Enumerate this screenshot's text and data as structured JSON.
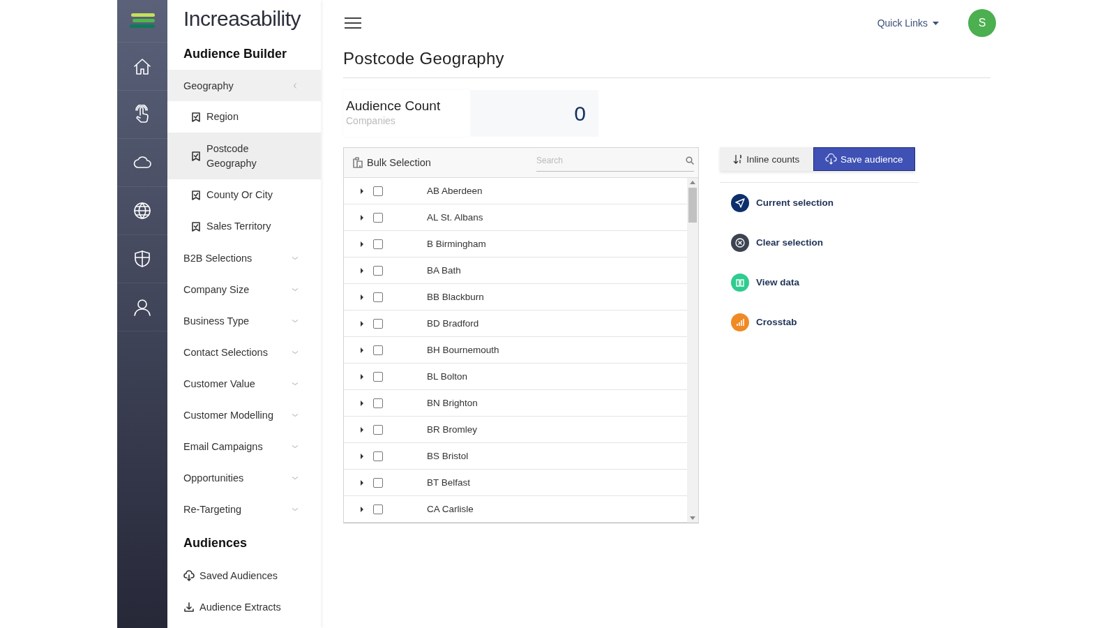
{
  "rail": {
    "items": [
      {
        "kind": "home"
      },
      {
        "kind": "touch"
      },
      {
        "kind": "cloud"
      },
      {
        "kind": "globe"
      },
      {
        "kind": "shield"
      },
      {
        "kind": "user"
      }
    ]
  },
  "sidebar": {
    "brand": "Increasability",
    "section": "Audience Builder",
    "items": [
      {
        "label": "Geography",
        "expanded": true,
        "children": [
          {
            "label": "Region",
            "selected": false
          },
          {
            "label": "Postcode Geography",
            "selected": true
          },
          {
            "label": "County Or City",
            "selected": false
          },
          {
            "label": "Sales Territory",
            "selected": false
          }
        ]
      },
      {
        "label": "B2B Selections",
        "expanded": false
      },
      {
        "label": "Company Size",
        "expanded": false
      },
      {
        "label": "Business Type",
        "expanded": false
      },
      {
        "label": "Contact Selections",
        "expanded": false
      },
      {
        "label": "Customer Value",
        "expanded": false
      },
      {
        "label": "Customer Modelling",
        "expanded": false
      },
      {
        "label": "Email Campaigns",
        "expanded": false
      },
      {
        "label": "Opportunities",
        "expanded": false
      },
      {
        "label": "Re-Targeting",
        "expanded": false
      }
    ],
    "audiences_title": "Audiences",
    "audiences": [
      {
        "label": "Saved Audiences",
        "kind": "saved"
      },
      {
        "label": "Audience Extracts",
        "kind": "extract"
      }
    ]
  },
  "header": {
    "quick_links": "Quick Links",
    "avatar": "S"
  },
  "page_title": "Postcode Geography",
  "audience_count": {
    "label": "Audience Count",
    "sublabel": "Companies",
    "value": "0"
  },
  "tree": {
    "title": "Bulk Selection",
    "search": {
      "placeholder": "Search"
    },
    "rows": [
      {
        "label": "AB Aberdeen",
        "checked": false,
        "expanded": false
      },
      {
        "label": "AL St. Albans",
        "checked": false,
        "expanded": false
      },
      {
        "label": "B Birmingham",
        "checked": false,
        "expanded": false
      },
      {
        "label": "BA Bath",
        "checked": false,
        "expanded": false
      },
      {
        "label": "BB Blackburn",
        "checked": false,
        "expanded": false
      },
      {
        "label": "BD Bradford",
        "checked": false,
        "expanded": false
      },
      {
        "label": "BH Bournemouth",
        "checked": false,
        "expanded": false
      },
      {
        "label": "BL Bolton",
        "checked": false,
        "expanded": false
      },
      {
        "label": "BN Brighton",
        "checked": false,
        "expanded": false
      },
      {
        "label": "BR Bromley",
        "checked": false,
        "expanded": false
      },
      {
        "label": "BS Bristol",
        "checked": false,
        "expanded": false
      },
      {
        "label": "BT Belfast",
        "checked": false,
        "expanded": false
      },
      {
        "label": "CA Carlisle",
        "checked": false,
        "expanded": false
      }
    ]
  },
  "toolbar": [
    {
      "label": "Inline counts",
      "kind": "counts"
    },
    {
      "label": "Save audience",
      "kind": "save"
    }
  ],
  "actions": [
    {
      "label": "Current selection",
      "kind": "current",
      "color": "#0d2f6b"
    },
    {
      "label": "Clear selection",
      "kind": "clear",
      "color": "#3d4350"
    },
    {
      "label": "View data",
      "kind": "view",
      "color": "#2ecc8f"
    },
    {
      "label": "Crosstab",
      "kind": "crosstab",
      "color": "#f08a24"
    }
  ]
}
